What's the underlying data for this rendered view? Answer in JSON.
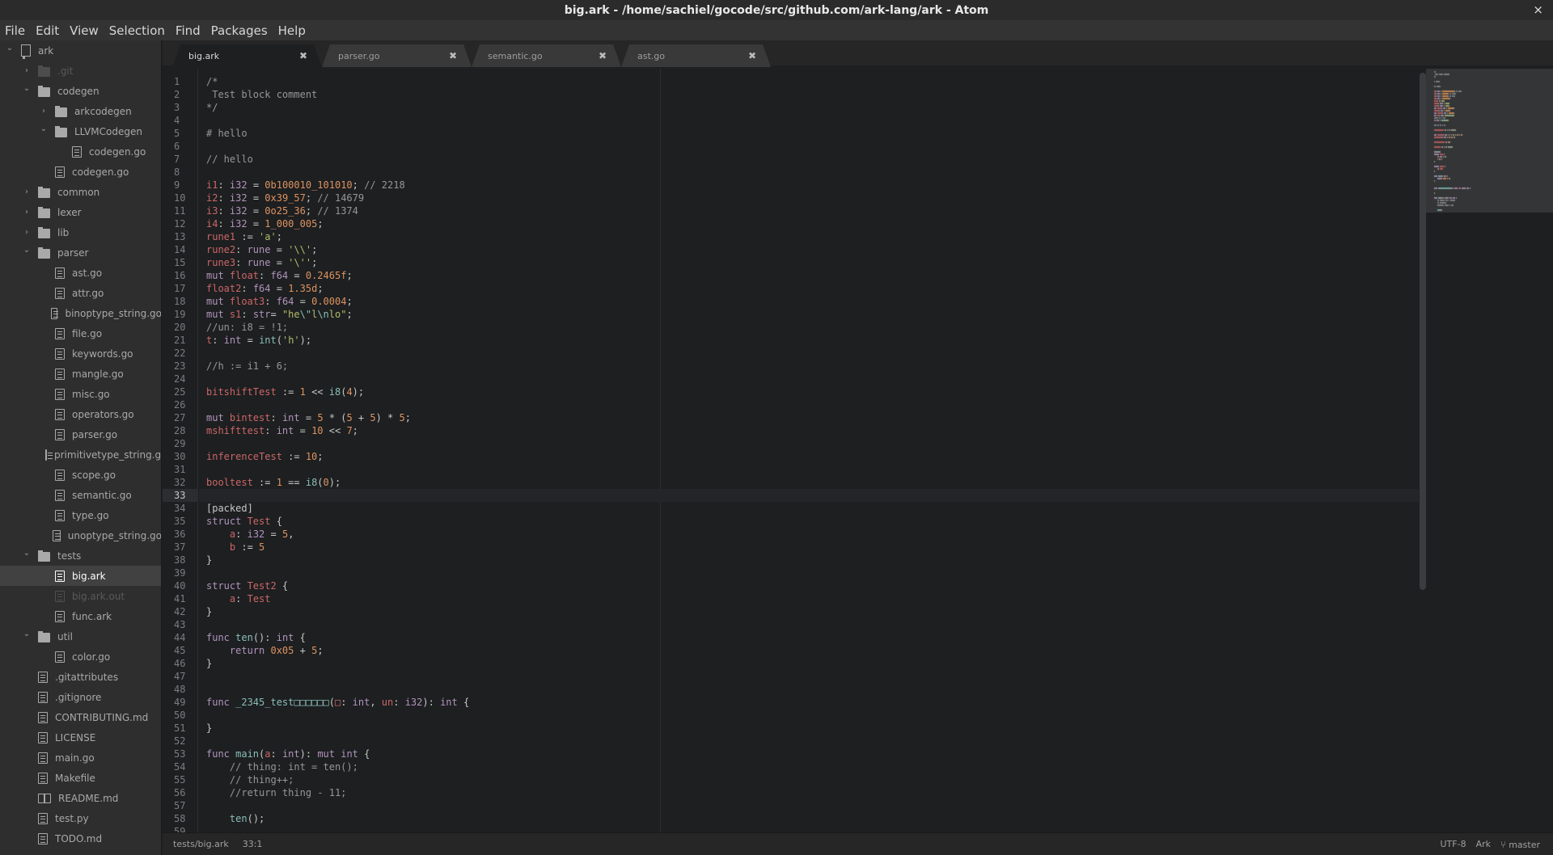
{
  "window": {
    "title": "big.ark - /home/sachiel/gocode/src/github.com/ark-lang/ark - Atom",
    "close_icon": "×"
  },
  "menu": [
    "File",
    "Edit",
    "View",
    "Selection",
    "Find",
    "Packages",
    "Help"
  ],
  "tree": [
    {
      "label": "ark",
      "depth": 0,
      "type": "repo",
      "arrow": "down"
    },
    {
      "label": ".git",
      "depth": 1,
      "type": "folder",
      "arrow": "right",
      "ignored": true
    },
    {
      "label": "codegen",
      "depth": 1,
      "type": "folder",
      "arrow": "down"
    },
    {
      "label": "arkcodegen",
      "depth": 2,
      "type": "folder",
      "arrow": "right"
    },
    {
      "label": "LLVMCodegen",
      "depth": 2,
      "type": "folder",
      "arrow": "down"
    },
    {
      "label": "codegen.go",
      "depth": 3,
      "type": "file"
    },
    {
      "label": "codegen.go",
      "depth": 2,
      "type": "file"
    },
    {
      "label": "common",
      "depth": 1,
      "type": "folder",
      "arrow": "right"
    },
    {
      "label": "lexer",
      "depth": 1,
      "type": "folder",
      "arrow": "right"
    },
    {
      "label": "lib",
      "depth": 1,
      "type": "folder",
      "arrow": "right"
    },
    {
      "label": "parser",
      "depth": 1,
      "type": "folder",
      "arrow": "down"
    },
    {
      "label": "ast.go",
      "depth": 2,
      "type": "file"
    },
    {
      "label": "attr.go",
      "depth": 2,
      "type": "file"
    },
    {
      "label": "binoptype_string.go",
      "depth": 2,
      "type": "file"
    },
    {
      "label": "file.go",
      "depth": 2,
      "type": "file"
    },
    {
      "label": "keywords.go",
      "depth": 2,
      "type": "file"
    },
    {
      "label": "mangle.go",
      "depth": 2,
      "type": "file"
    },
    {
      "label": "misc.go",
      "depth": 2,
      "type": "file"
    },
    {
      "label": "operators.go",
      "depth": 2,
      "type": "file"
    },
    {
      "label": "parser.go",
      "depth": 2,
      "type": "file"
    },
    {
      "label": "primitivetype_string.go",
      "depth": 2,
      "type": "file"
    },
    {
      "label": "scope.go",
      "depth": 2,
      "type": "file"
    },
    {
      "label": "semantic.go",
      "depth": 2,
      "type": "file"
    },
    {
      "label": "type.go",
      "depth": 2,
      "type": "file"
    },
    {
      "label": "unoptype_string.go",
      "depth": 2,
      "type": "file"
    },
    {
      "label": "tests",
      "depth": 1,
      "type": "folder",
      "arrow": "down"
    },
    {
      "label": "big.ark",
      "depth": 2,
      "type": "file",
      "selected": true
    },
    {
      "label": "big.ark.out",
      "depth": 2,
      "type": "file",
      "ignored": true
    },
    {
      "label": "func.ark",
      "depth": 2,
      "type": "file"
    },
    {
      "label": "util",
      "depth": 1,
      "type": "folder",
      "arrow": "down"
    },
    {
      "label": "color.go",
      "depth": 2,
      "type": "file"
    },
    {
      "label": ".gitattributes",
      "depth": 1,
      "type": "file"
    },
    {
      "label": ".gitignore",
      "depth": 1,
      "type": "file"
    },
    {
      "label": "CONTRIBUTING.md",
      "depth": 1,
      "type": "file"
    },
    {
      "label": "LICENSE",
      "depth": 1,
      "type": "file"
    },
    {
      "label": "main.go",
      "depth": 1,
      "type": "file"
    },
    {
      "label": "Makefile",
      "depth": 1,
      "type": "file"
    },
    {
      "label": "README.md",
      "depth": 1,
      "type": "book"
    },
    {
      "label": "test.py",
      "depth": 1,
      "type": "file"
    },
    {
      "label": "TODO.md",
      "depth": 1,
      "type": "file"
    }
  ],
  "tabs": [
    {
      "label": "big.ark",
      "active": true
    },
    {
      "label": "parser.go",
      "active": false
    },
    {
      "label": "semantic.go",
      "active": false
    },
    {
      "label": "ast.go",
      "active": false
    }
  ],
  "tab_close_icon": "✖",
  "editor": {
    "current_line": 33,
    "lines": [
      [
        [
          "c",
          "/*"
        ]
      ],
      [
        [
          "c",
          " Test block comment"
        ]
      ],
      [
        [
          "c",
          "*/"
        ]
      ],
      [],
      [
        [
          "c",
          "# hello"
        ]
      ],
      [],
      [
        [
          "c",
          "// hello"
        ]
      ],
      [],
      [
        [
          "v",
          "i1"
        ],
        [
          "o",
          ": "
        ],
        [
          "t",
          "i32"
        ],
        [
          "o",
          " = "
        ],
        [
          "n",
          "0b100010_101010"
        ],
        [
          "o",
          "; "
        ],
        [
          "c",
          "// 2218"
        ]
      ],
      [
        [
          "v",
          "i2"
        ],
        [
          "o",
          ": "
        ],
        [
          "t",
          "i32"
        ],
        [
          "o",
          " = "
        ],
        [
          "n",
          "0x39_57"
        ],
        [
          "o",
          "; "
        ],
        [
          "c",
          "// 14679"
        ]
      ],
      [
        [
          "v",
          "i3"
        ],
        [
          "o",
          ": "
        ],
        [
          "t",
          "i32"
        ],
        [
          "o",
          " = "
        ],
        [
          "n",
          "0o25_36"
        ],
        [
          "o",
          "; "
        ],
        [
          "c",
          "// 1374"
        ]
      ],
      [
        [
          "v",
          "i4"
        ],
        [
          "o",
          ": "
        ],
        [
          "t",
          "i32"
        ],
        [
          "o",
          " = "
        ],
        [
          "n",
          "1_000_005"
        ],
        [
          "o",
          ";"
        ]
      ],
      [
        [
          "v",
          "rune1"
        ],
        [
          "o",
          " := "
        ],
        [
          "s",
          "'a'"
        ],
        [
          "o",
          ";"
        ]
      ],
      [
        [
          "v",
          "rune2"
        ],
        [
          "o",
          ": "
        ],
        [
          "t",
          "rune"
        ],
        [
          "o",
          " = "
        ],
        [
          "s",
          "'\\\\'"
        ],
        [
          "o",
          ";"
        ]
      ],
      [
        [
          "v",
          "rune3"
        ],
        [
          "o",
          ": "
        ],
        [
          "t",
          "rune"
        ],
        [
          "o",
          " = "
        ],
        [
          "s",
          "'\\''"
        ],
        [
          "o",
          ";"
        ]
      ],
      [
        [
          "k",
          "mut "
        ],
        [
          "v",
          "float"
        ],
        [
          "o",
          ": "
        ],
        [
          "t",
          "f64"
        ],
        [
          "o",
          " = "
        ],
        [
          "n",
          "0.2465f"
        ],
        [
          "o",
          ";"
        ]
      ],
      [
        [
          "v",
          "float2"
        ],
        [
          "o",
          ": "
        ],
        [
          "t",
          "f64"
        ],
        [
          "o",
          " = "
        ],
        [
          "n",
          "1.35d"
        ],
        [
          "o",
          ";"
        ]
      ],
      [
        [
          "k",
          "mut "
        ],
        [
          "v",
          "float3"
        ],
        [
          "o",
          ": "
        ],
        [
          "t",
          "f64"
        ],
        [
          "o",
          " = "
        ],
        [
          "n",
          "0.0004"
        ],
        [
          "o",
          ";"
        ]
      ],
      [
        [
          "k",
          "mut "
        ],
        [
          "v",
          "s1"
        ],
        [
          "o",
          ": "
        ],
        [
          "t",
          "str"
        ],
        [
          "o",
          "= "
        ],
        [
          "s",
          "\"he"
        ],
        [
          "f",
          "\\\""
        ],
        [
          "s",
          "l"
        ],
        [
          "f",
          "\\n"
        ],
        [
          "s",
          "lo\""
        ],
        [
          "o",
          ";"
        ]
      ],
      [
        [
          "c",
          "//un: i8 = !1;"
        ]
      ],
      [
        [
          "v",
          "t"
        ],
        [
          "o",
          ": "
        ],
        [
          "t",
          "int"
        ],
        [
          "o",
          " = "
        ],
        [
          "f",
          "int"
        ],
        [
          "o",
          "("
        ],
        [
          "s",
          "'h'"
        ],
        [
          "o",
          ");"
        ]
      ],
      [],
      [
        [
          "c",
          "//h := i1 + 6;"
        ]
      ],
      [],
      [
        [
          "v",
          "bitshiftTest"
        ],
        [
          "o",
          " := "
        ],
        [
          "n",
          "1"
        ],
        [
          "o",
          " << "
        ],
        [
          "f",
          "i8"
        ],
        [
          "o",
          "("
        ],
        [
          "n",
          "4"
        ],
        [
          "o",
          ");"
        ]
      ],
      [],
      [
        [
          "k",
          "mut "
        ],
        [
          "v",
          "bintest"
        ],
        [
          "o",
          ": "
        ],
        [
          "t",
          "int"
        ],
        [
          "o",
          " = "
        ],
        [
          "n",
          "5"
        ],
        [
          "o",
          " * ("
        ],
        [
          "n",
          "5"
        ],
        [
          "o",
          " + "
        ],
        [
          "n",
          "5"
        ],
        [
          "o",
          ") * "
        ],
        [
          "n",
          "5"
        ],
        [
          "o",
          ";"
        ]
      ],
      [
        [
          "v",
          "mshifttest"
        ],
        [
          "o",
          ": "
        ],
        [
          "t",
          "int"
        ],
        [
          "o",
          " = "
        ],
        [
          "n",
          "10"
        ],
        [
          "o",
          " << "
        ],
        [
          "n",
          "7"
        ],
        [
          "o",
          ";"
        ]
      ],
      [],
      [
        [
          "v",
          "inferenceTest"
        ],
        [
          "o",
          " := "
        ],
        [
          "n",
          "10"
        ],
        [
          "o",
          ";"
        ]
      ],
      [],
      [
        [
          "v",
          "booltest"
        ],
        [
          "o",
          " := "
        ],
        [
          "n",
          "1"
        ],
        [
          "o",
          " == "
        ],
        [
          "f",
          "i8"
        ],
        [
          "o",
          "("
        ],
        [
          "n",
          "0"
        ],
        [
          "o",
          ");"
        ]
      ],
      [],
      [
        [
          "o",
          "[packed]"
        ]
      ],
      [
        [
          "k",
          "struct "
        ],
        [
          "v",
          "Test"
        ],
        [
          "o",
          " {"
        ]
      ],
      [
        [
          "o",
          "    "
        ],
        [
          "v",
          "a"
        ],
        [
          "o",
          ": "
        ],
        [
          "t",
          "i32"
        ],
        [
          "o",
          " = "
        ],
        [
          "n",
          "5"
        ],
        [
          "o",
          ","
        ]
      ],
      [
        [
          "o",
          "    "
        ],
        [
          "v",
          "b"
        ],
        [
          "o",
          " := "
        ],
        [
          "n",
          "5"
        ]
      ],
      [
        [
          "o",
          "}"
        ]
      ],
      [],
      [
        [
          "k",
          "struct "
        ],
        [
          "v",
          "Test2"
        ],
        [
          "o",
          " {"
        ]
      ],
      [
        [
          "o",
          "    "
        ],
        [
          "v",
          "a"
        ],
        [
          "o",
          ": "
        ],
        [
          "v",
          "Test"
        ]
      ],
      [
        [
          "o",
          "}"
        ]
      ],
      [],
      [
        [
          "k",
          "func "
        ],
        [
          "f",
          "ten"
        ],
        [
          "o",
          "(): "
        ],
        [
          "t",
          "int"
        ],
        [
          "o",
          " {"
        ]
      ],
      [
        [
          "o",
          "    "
        ],
        [
          "k",
          "return "
        ],
        [
          "n",
          "0x05"
        ],
        [
          "o",
          " + "
        ],
        [
          "n",
          "5"
        ],
        [
          "o",
          ";"
        ]
      ],
      [
        [
          "o",
          "}"
        ]
      ],
      [],
      [],
      [
        [
          "k",
          "func "
        ],
        [
          "f",
          "_2345_test□□□□□□"
        ],
        [
          "o",
          "("
        ],
        [
          "v",
          "□"
        ],
        [
          "o",
          ": "
        ],
        [
          "t",
          "int"
        ],
        [
          "o",
          ", "
        ],
        [
          "v",
          "un"
        ],
        [
          "o",
          ": "
        ],
        [
          "t",
          "i32"
        ],
        [
          "o",
          "): "
        ],
        [
          "t",
          "int"
        ],
        [
          "o",
          " {"
        ]
      ],
      [],
      [
        [
          "o",
          "}"
        ]
      ],
      [],
      [
        [
          "k",
          "func "
        ],
        [
          "f",
          "main"
        ],
        [
          "o",
          "("
        ],
        [
          "v",
          "a"
        ],
        [
          "o",
          ": "
        ],
        [
          "t",
          "int"
        ],
        [
          "o",
          "): "
        ],
        [
          "k",
          "mut "
        ],
        [
          "t",
          "int"
        ],
        [
          "o",
          " {"
        ]
      ],
      [
        [
          "o",
          "    "
        ],
        [
          "c",
          "// thing: int = ten();"
        ]
      ],
      [
        [
          "o",
          "    "
        ],
        [
          "c",
          "// thing++;"
        ]
      ],
      [
        [
          "o",
          "    "
        ],
        [
          "c",
          "//return thing - 11;"
        ]
      ],
      [],
      [
        [
          "o",
          "    "
        ],
        [
          "f",
          "ten"
        ],
        [
          "o",
          "();"
        ]
      ],
      []
    ]
  },
  "status": {
    "file_path": "tests/big.ark",
    "cursor": "33:1",
    "encoding": "UTF-8",
    "grammar": "Ark",
    "branch_icon": "⑂",
    "branch": "master"
  }
}
